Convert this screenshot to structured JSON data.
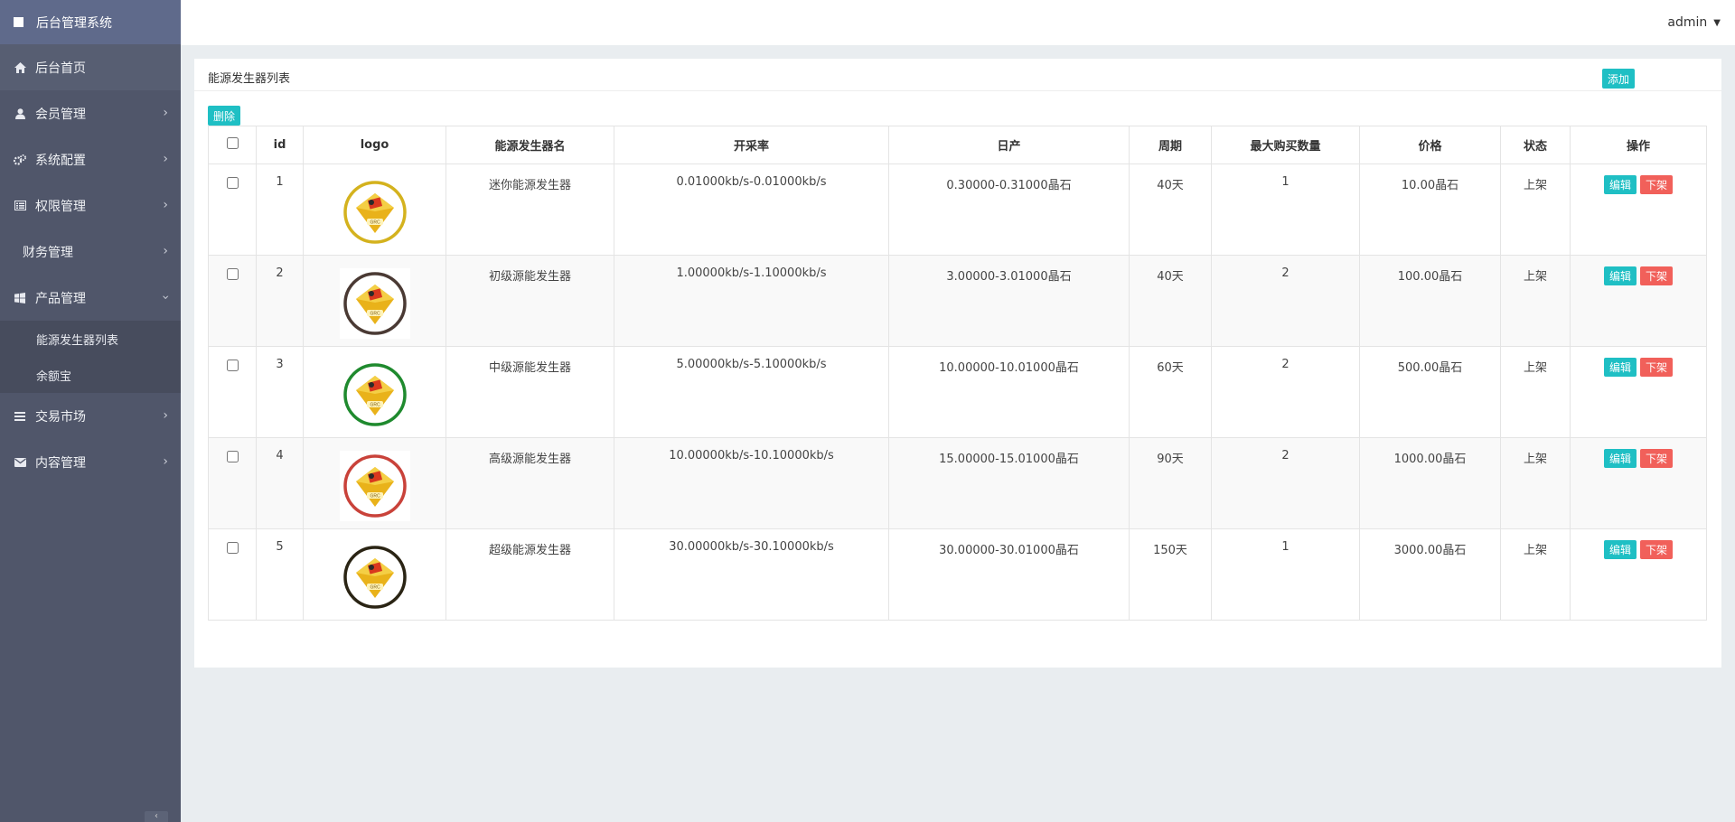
{
  "app": {
    "title": "后台管理系统"
  },
  "header": {
    "user": "admin"
  },
  "sidebar": {
    "items": [
      {
        "label": "后台首页",
        "icon": "home-icon"
      },
      {
        "label": "会员管理",
        "icon": "user-icon"
      },
      {
        "label": "系统配置",
        "icon": "gears-icon"
      },
      {
        "label": "权限管理",
        "icon": "list-alt-icon"
      },
      {
        "label": "财务管理",
        "icon": ""
      },
      {
        "label": "产品管理",
        "icon": "windows-icon"
      },
      {
        "label": "交易市场",
        "icon": "bars-icon"
      },
      {
        "label": "内容管理",
        "icon": "envelope-icon"
      }
    ],
    "submenu": [
      "能源发生器列表",
      "余额宝"
    ]
  },
  "panel": {
    "title": "能源发生器列表",
    "add_label": "添加",
    "delete_label": "删除"
  },
  "table": {
    "headers": [
      "id",
      "logo",
      "能源发生器名",
      "开采率",
      "日产",
      "周期",
      "最大购买数量",
      "价格",
      "状态",
      "操作"
    ],
    "rows": [
      {
        "id": "1",
        "name": "迷你能源发生器",
        "rate": "0.01000kb/s-0.01000kb/s",
        "daily": "0.30000-0.31000晶石",
        "cycle": "40天",
        "max": "1",
        "price": "10.00晶石",
        "status": "上架",
        "ring": "#d4b21e"
      },
      {
        "id": "2",
        "name": "初级源能发生器",
        "rate": "1.00000kb/s-1.10000kb/s",
        "daily": "3.00000-3.01000晶石",
        "cycle": "40天",
        "max": "2",
        "price": "100.00晶石",
        "status": "上架",
        "ring": "#4a3a34"
      },
      {
        "id": "3",
        "name": "中级源能发生器",
        "rate": "5.00000kb/s-5.10000kb/s",
        "daily": "10.00000-10.01000晶石",
        "cycle": "60天",
        "max": "2",
        "price": "500.00晶石",
        "status": "上架",
        "ring": "#1f8a2e"
      },
      {
        "id": "4",
        "name": "高级源能发生器",
        "rate": "10.00000kb/s-10.10000kb/s",
        "daily": "15.00000-15.01000晶石",
        "cycle": "90天",
        "max": "2",
        "price": "1000.00晶石",
        "status": "上架",
        "ring": "#c9423a"
      },
      {
        "id": "5",
        "name": "超级能源发生器",
        "rate": "30.00000kb/s-30.10000kb/s",
        "daily": "30.00000-30.01000晶石",
        "cycle": "150天",
        "max": "1",
        "price": "3000.00晶石",
        "status": "上架",
        "ring": "#2a2414"
      }
    ],
    "edit_label": "编辑",
    "offshelf_label": "下架"
  },
  "colors": {
    "accent": "#1fbfc4",
    "danger": "#f1605a",
    "sidebar": "#50566a"
  }
}
